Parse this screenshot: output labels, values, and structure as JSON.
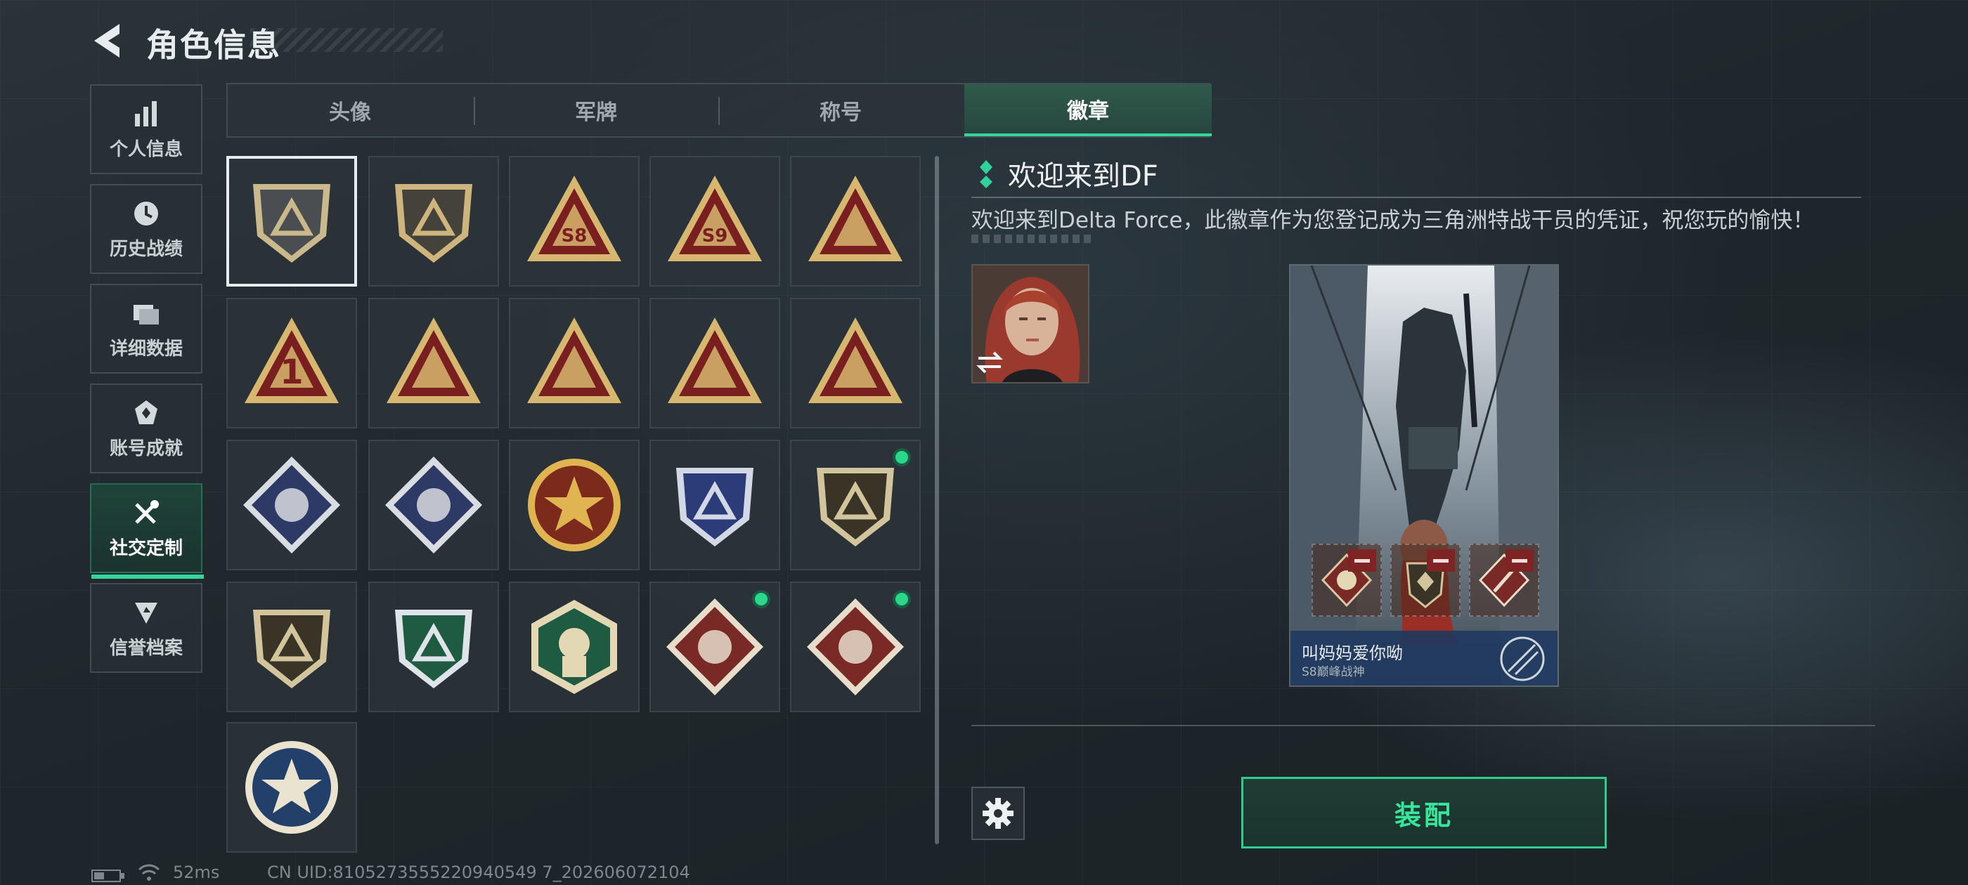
{
  "header": {
    "title": "角色信息",
    "back_icon": "chevron-left-icon"
  },
  "nav": {
    "items": [
      {
        "label": "个人信息",
        "icon": "bar-chart-icon",
        "active": false
      },
      {
        "label": "历史战绩",
        "icon": "clock-icon",
        "active": false
      },
      {
        "label": "详细数据",
        "icon": "folder-icon",
        "active": false
      },
      {
        "label": "账号成就",
        "icon": "trophy-icon",
        "active": false
      },
      {
        "label": "社交定制",
        "icon": "tools-icon",
        "active": true
      },
      {
        "label": "信誉档案",
        "icon": "shield-arrow-icon",
        "active": false
      }
    ]
  },
  "tabs": [
    {
      "label": "头像",
      "active": false
    },
    {
      "label": "军牌",
      "active": false
    },
    {
      "label": "称号",
      "active": false
    },
    {
      "label": "徽章",
      "active": true
    }
  ],
  "badges": [
    {
      "name": "delta-emblem",
      "shape": "shield",
      "bg": "#4a4e50",
      "accent": "#c9b98d",
      "selected": true,
      "new": false
    },
    {
      "name": "helicopter-emblem",
      "shape": "shield",
      "bg": "#44423a",
      "accent": "#cdb57d",
      "selected": false,
      "new": false
    },
    {
      "name": "s8-emblem",
      "shape": "triangle",
      "bg": "#7a1f1f",
      "accent": "#d7b66f",
      "text": "S8",
      "selected": false,
      "new": false
    },
    {
      "name": "s9-emblem",
      "shape": "triangle",
      "bg": "#7a1f1f",
      "accent": "#d7b66f",
      "text": "S9",
      "selected": false,
      "new": false
    },
    {
      "name": "nest-emblem",
      "shape": "triangle",
      "bg": "#7a1f1f",
      "accent": "#d7b66f",
      "selected": false,
      "new": false
    },
    {
      "name": "number-one-emblem",
      "shape": "triangle",
      "bg": "#7a1f1f",
      "accent": "#d7b66f",
      "text": "1",
      "selected": false,
      "new": false
    },
    {
      "name": "usb-emblem",
      "shape": "triangle",
      "bg": "#7a1f1f",
      "accent": "#d7b66f",
      "selected": false,
      "new": false
    },
    {
      "name": "soldier-emblem",
      "shape": "triangle",
      "bg": "#7a1f1f",
      "accent": "#d7b66f",
      "selected": false,
      "new": false
    },
    {
      "name": "hands-emblem",
      "shape": "triangle",
      "bg": "#7a1f1f",
      "accent": "#d7b66f",
      "selected": false,
      "new": false
    },
    {
      "name": "squad-emblem",
      "shape": "triangle",
      "bg": "#7a1f1f",
      "accent": "#d7b66f",
      "selected": false,
      "new": false
    },
    {
      "name": "rose-emblem",
      "shape": "diamond",
      "bg": "#2e3a66",
      "accent": "#d9dce0",
      "selected": false,
      "new": false
    },
    {
      "name": "launcher-emblem",
      "shape": "diamond",
      "bg": "#2e3a66",
      "accent": "#d9dce0",
      "selected": false,
      "new": false
    },
    {
      "name": "star-emblem",
      "shape": "circle",
      "bg": "#7b2a1c",
      "accent": "#e0b451",
      "selected": false,
      "new": false
    },
    {
      "name": "wing-shield-emblem",
      "shape": "shield",
      "bg": "#2c3c78",
      "accent": "#d3d8e6",
      "selected": false,
      "new": false
    },
    {
      "name": "gem-shield-emblem",
      "shape": "shield",
      "bg": "#3a3427",
      "accent": "#d2c49c",
      "selected": false,
      "new": true
    },
    {
      "name": "rifle-emblem",
      "shape": "shield",
      "bg": "#3a3427",
      "accent": "#d2c49c",
      "selected": false,
      "new": false
    },
    {
      "name": "target-emblem",
      "shape": "shield",
      "bg": "#1f5a43",
      "accent": "#dfe4e8",
      "selected": false,
      "new": false
    },
    {
      "name": "fighter-emblem",
      "shape": "hexagon",
      "bg": "#1f5a43",
      "accent": "#e3d7b4",
      "selected": false,
      "new": false
    },
    {
      "name": "horse-emblem",
      "shape": "diamond",
      "bg": "#7a2a26",
      "accent": "#e8dccb",
      "selected": false,
      "new": true
    },
    {
      "name": "tools-emblem",
      "shape": "diamond",
      "bg": "#7a2a26",
      "accent": "#e8dccb",
      "selected": false,
      "new": true
    },
    {
      "name": "camera-emblem",
      "shape": "circle",
      "bg": "#23406a",
      "accent": "#e9e3cf",
      "selected": false,
      "new": false
    }
  ],
  "detail": {
    "title": "欢迎来到DF",
    "description": "欢迎来到Delta Force，此徽章作为您登记成为三角洲特战干员的凭证，祝您玩的愉快！"
  },
  "card": {
    "player_name": "叫妈妈爱你呦",
    "rank_title": "S8巅峰战神"
  },
  "actions": {
    "equip_label": "装配",
    "settings_icon": "gear-icon",
    "swap_icon": "swap-icon"
  },
  "status": {
    "ping": "52ms",
    "uid": "CN UID:8105273555220940549 7_202606072104"
  },
  "colors": {
    "accent_green": "#36d59a",
    "new_dot": "#29d889"
  }
}
